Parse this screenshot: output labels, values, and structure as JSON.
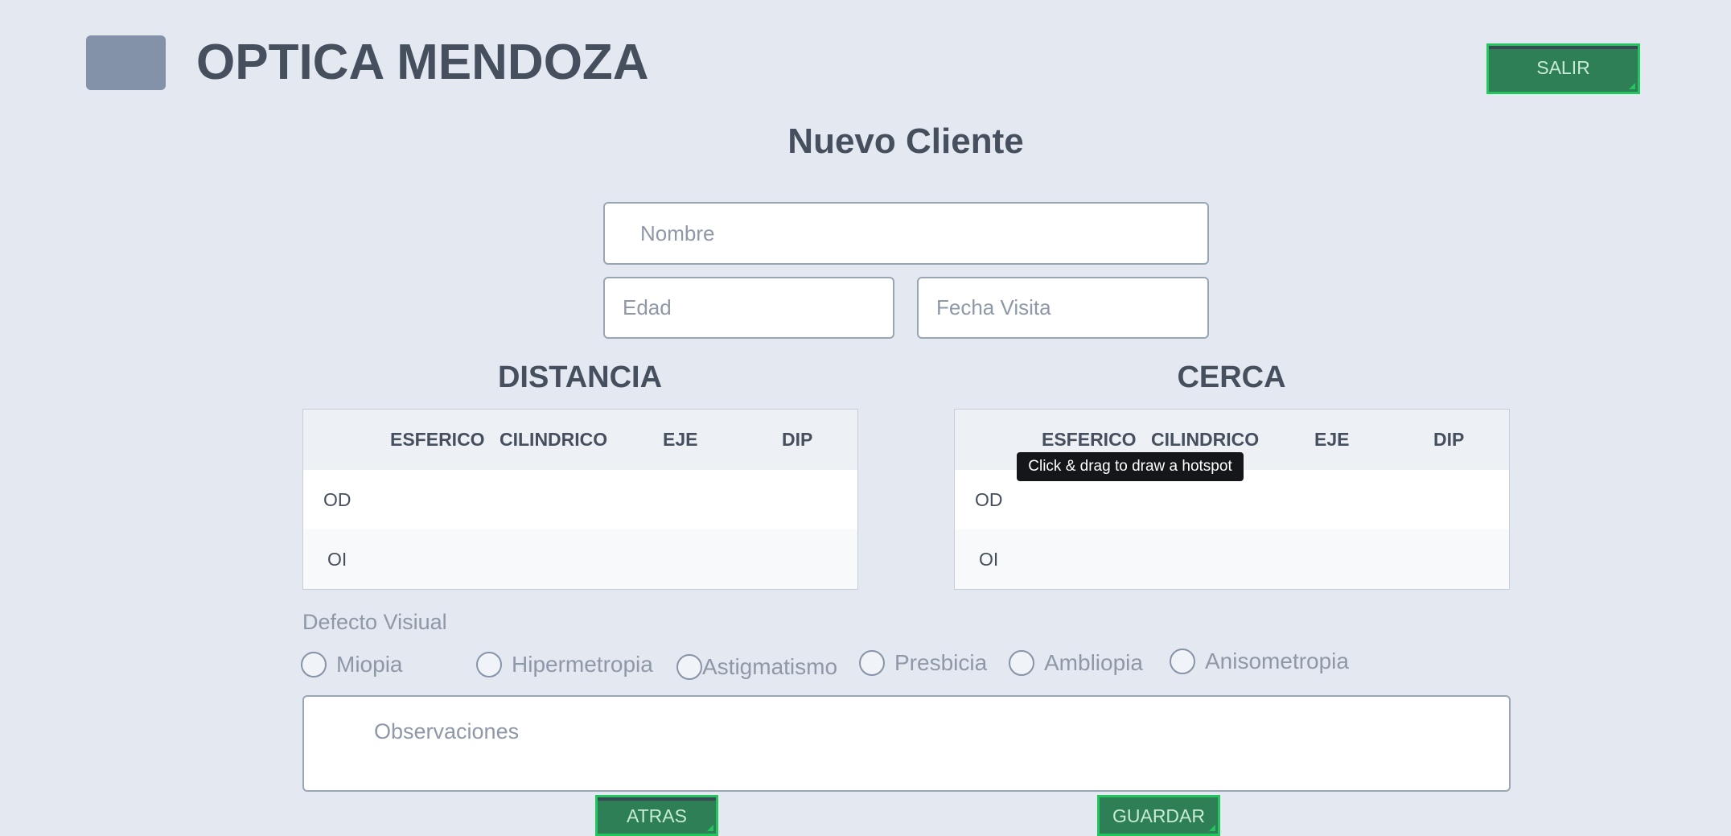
{
  "header": {
    "app_title": "OPTICA MENDOZA",
    "exit_label": "SALIR"
  },
  "page_title": "Nuevo Cliente",
  "form": {
    "nombre_placeholder": "Nombre",
    "edad_placeholder": "Edad",
    "fecha_placeholder": "Fecha Visita"
  },
  "distancia": {
    "title": "DISTANCIA",
    "columns": [
      "ESFERICO",
      "CILINDRICO",
      "EJE",
      "DIP"
    ],
    "rows": [
      "OD",
      "OI"
    ]
  },
  "cerca": {
    "title": "CERCA",
    "columns": [
      "ESFERICO",
      "CILINDRICO",
      "EJE",
      "DIP"
    ],
    "rows": [
      "OD",
      "OI"
    ]
  },
  "defecto": {
    "label": "Defecto Visiual",
    "options": [
      "Miopia",
      "Hipermetropia",
      "Astigmatismo",
      "Presbicia",
      "Ambliopia",
      "Anisometropia"
    ]
  },
  "observaciones_placeholder": "Observaciones",
  "buttons": {
    "back": "ATRAS",
    "save": "GUARDAR"
  },
  "tooltip": "Click & drag to draw a hotspot",
  "colors": {
    "background": "#e3e8f1",
    "button_fill": "#2e7f55",
    "button_border": "#22c55e",
    "logo": "#8392a8"
  }
}
